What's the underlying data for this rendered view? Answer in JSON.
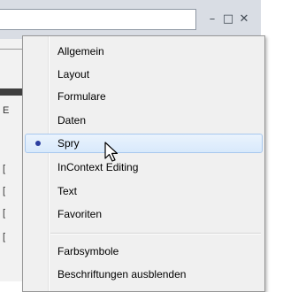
{
  "window": {
    "minimize_glyph": "–",
    "maximize_glyph": "□",
    "close_glyph": "✕"
  },
  "background": {
    "fragments": [
      "E",
      "[",
      "[",
      "[",
      "["
    ]
  },
  "menu": {
    "items": [
      {
        "label": "Allgemein",
        "selected": false
      },
      {
        "label": "Layout",
        "selected": false
      },
      {
        "label": "Formulare",
        "selected": false
      },
      {
        "label": "Daten",
        "selected": false
      },
      {
        "label": "Spry",
        "selected": true
      },
      {
        "label": "InContext Editing",
        "selected": false
      },
      {
        "label": "Text",
        "selected": false
      },
      {
        "label": "Favoriten",
        "selected": false
      },
      {
        "label": "Farbsymbole",
        "selected": false
      },
      {
        "label": "Beschriftungen ausblenden",
        "selected": false
      }
    ],
    "highlight_color": "#d8e9fb",
    "radio_color": "#2b3ea0"
  }
}
